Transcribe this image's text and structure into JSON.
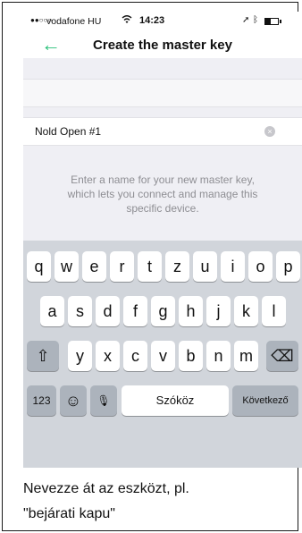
{
  "status_bar": {
    "signal_dots": "●●○○○",
    "carrier": "vodafone HU",
    "time": "14:23",
    "wifi_icon": "wifi-icon",
    "location_icon": "location-arrow-icon",
    "bluetooth_icon": "bluetooth-icon",
    "battery_level": 0.45
  },
  "nav": {
    "back_glyph": "←",
    "title": "Create the master key"
  },
  "form": {
    "name_value": "Nold Open #1",
    "clear_glyph": "×",
    "hint": "Enter a name for your new master key, which lets you connect and manage this specific device."
  },
  "keyboard": {
    "row1": [
      "q",
      "w",
      "e",
      "r",
      "t",
      "z",
      "u",
      "i",
      "o",
      "p"
    ],
    "row2": [
      "a",
      "s",
      "d",
      "f",
      "g",
      "h",
      "j",
      "k",
      "l"
    ],
    "row3": [
      "y",
      "x",
      "c",
      "v",
      "b",
      "n",
      "m"
    ],
    "shift_glyph": "⇧",
    "delete_glyph": "⌫",
    "numbers_label": "123",
    "emoji_glyph": "☺",
    "mic_glyph": "🎙",
    "space_label": "Szóköz",
    "next_label": "Következő"
  },
  "caption": {
    "line1": "Nevezze át az eszközt, pl.",
    "line2": "\"bejárati kapu\""
  },
  "colors": {
    "accent": "#2bc27a",
    "keyboard_bg": "#d1d5db",
    "function_key": "#acb3bc"
  }
}
